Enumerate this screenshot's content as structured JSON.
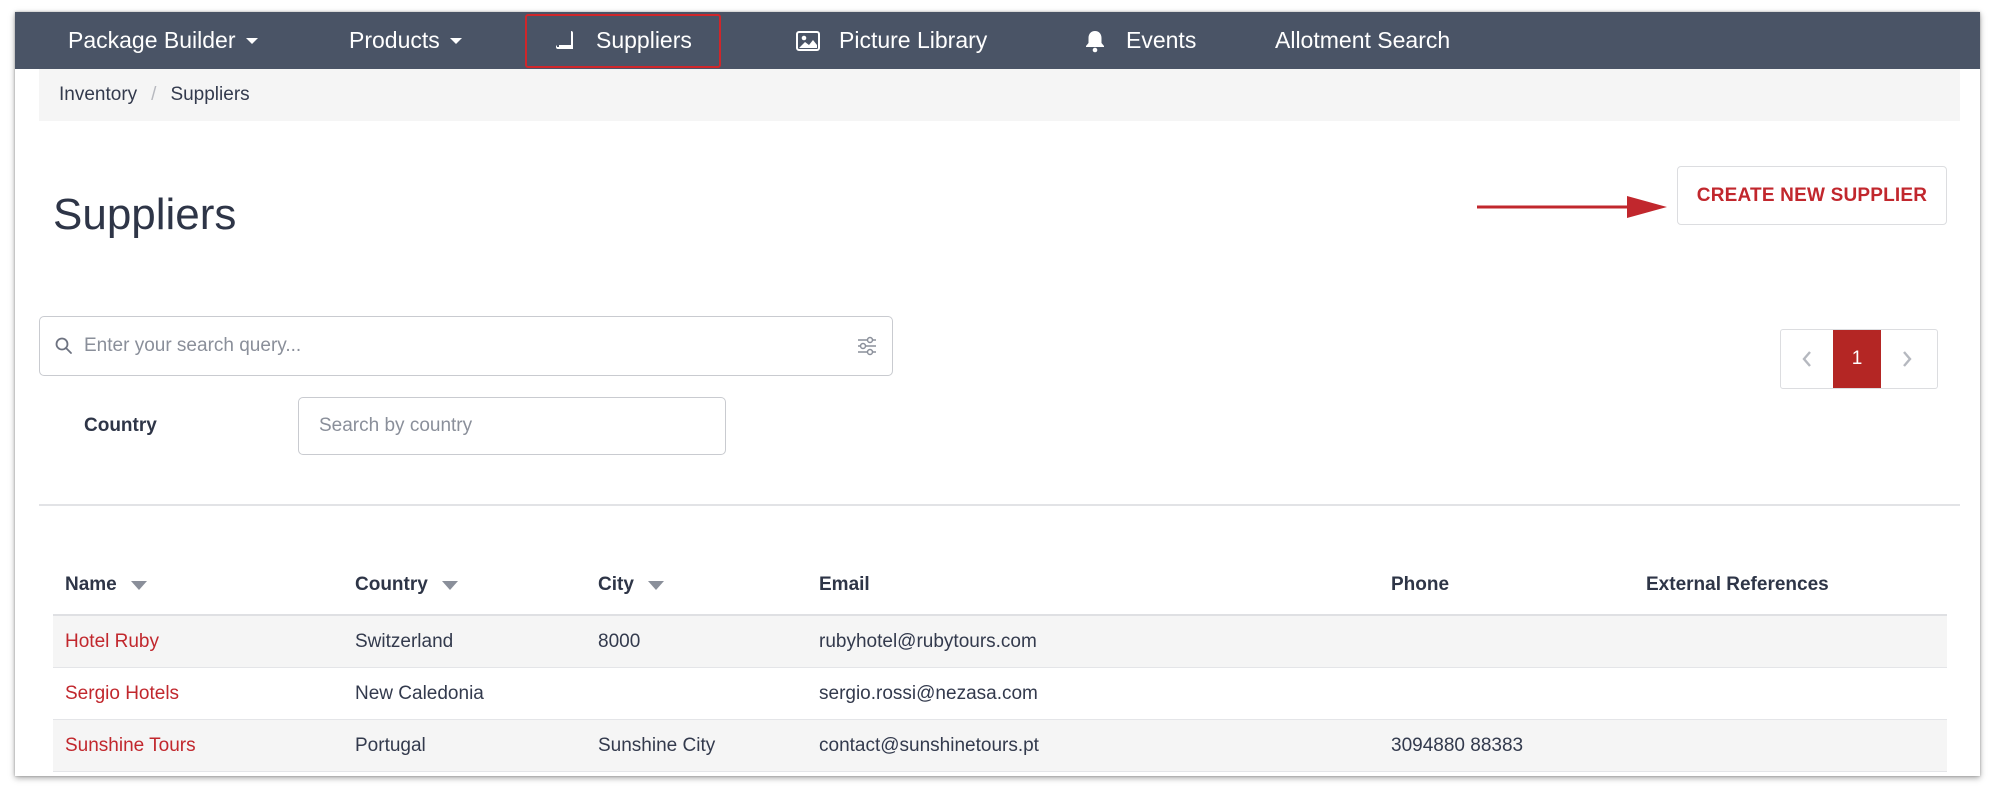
{
  "nav": {
    "items": [
      {
        "label": "Package Builder",
        "icon": "",
        "dropdown": true
      },
      {
        "label": "Products",
        "icon": "",
        "dropdown": true
      },
      {
        "label": "Suppliers",
        "icon": "book-icon",
        "dropdown": false,
        "active": true
      },
      {
        "label": "Picture Library",
        "icon": "image-icon",
        "dropdown": false
      },
      {
        "label": "Events",
        "icon": "bell-icon",
        "dropdown": false
      },
      {
        "label": "Allotment Search",
        "icon": "",
        "dropdown": false
      }
    ],
    "highlight_color": "#d0262a",
    "background": "#4a5466"
  },
  "breadcrumb": {
    "items": [
      "Inventory",
      "Suppliers"
    ]
  },
  "page": {
    "title": "Suppliers",
    "create_button": "CREATE NEW SUPPLIER",
    "accent": "#c1272d"
  },
  "search": {
    "placeholder": "Enter your search query...",
    "value": ""
  },
  "filters": {
    "country_label": "Country",
    "country_placeholder": "Search by country"
  },
  "pagination": {
    "current_page": "1"
  },
  "table": {
    "columns": [
      "Name",
      "Country",
      "City",
      "Email",
      "Phone",
      "External References"
    ],
    "rows": [
      {
        "name": "Hotel Ruby",
        "country": "Switzerland",
        "city": "8000",
        "email": "rubyhotel@rubytours.com",
        "phone": "",
        "external": ""
      },
      {
        "name": "Sergio Hotels",
        "country": "New Caledonia",
        "city": "",
        "email": "sergio.rossi@nezasa.com",
        "phone": "",
        "external": ""
      },
      {
        "name": "Sunshine Tours",
        "country": "Portugal",
        "city": "Sunshine City",
        "email": "contact@sunshinetours.pt",
        "phone": "3094880 88383",
        "external": ""
      }
    ]
  }
}
